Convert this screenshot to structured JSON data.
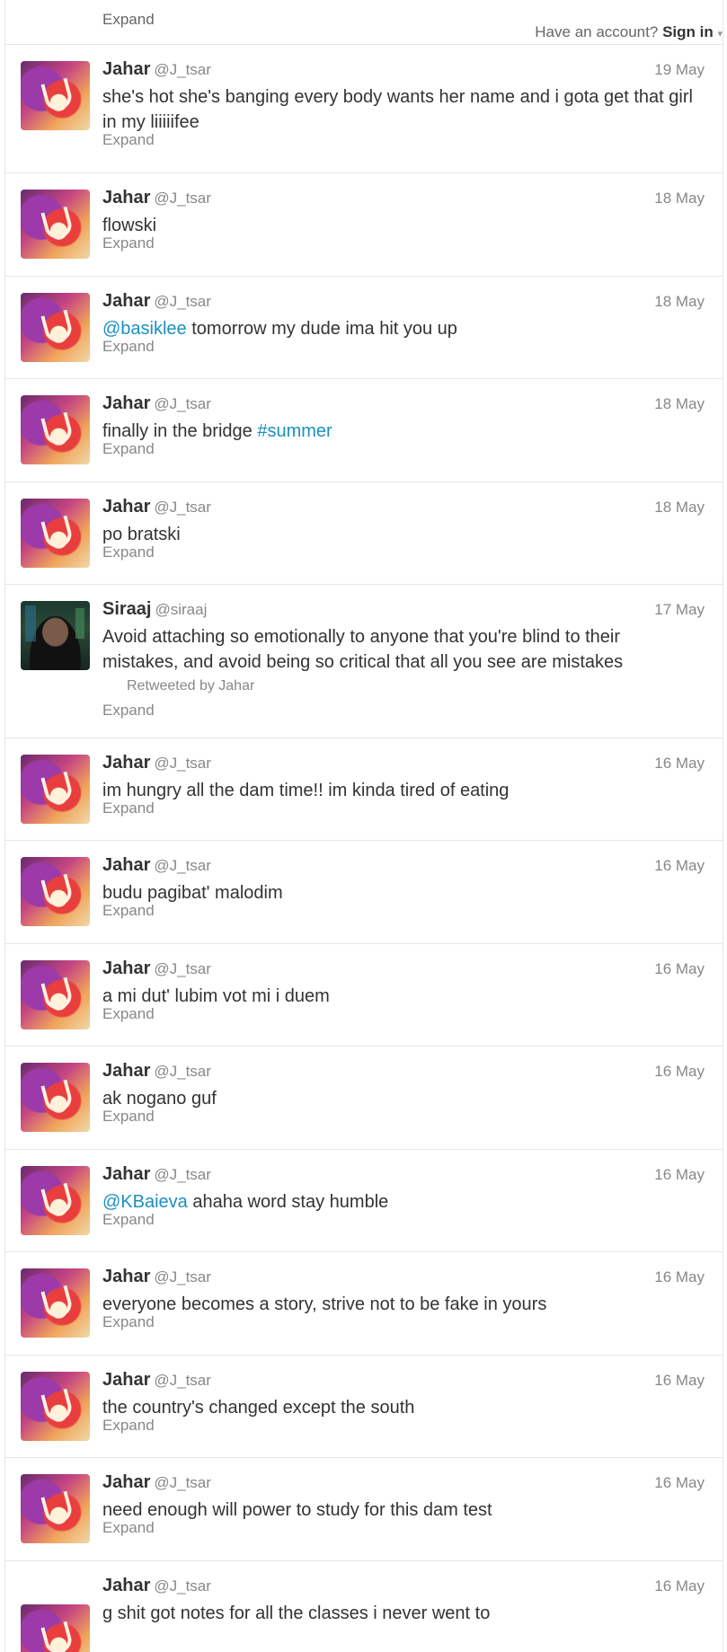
{
  "header": {
    "account_prompt": "Have an account?",
    "sign_in": "Sign in",
    "caret": "▾"
  },
  "first_expand": "Expand",
  "expand_label": "Expand",
  "tweets": [
    {
      "name": "Jahar",
      "handle": "@J_tsar",
      "time": "19 May",
      "avatar": "jahar",
      "text": [
        {
          "t": "she's hot she's banging every body wants her name and i gota get that girl in my liiiiifee"
        }
      ]
    },
    {
      "name": "Jahar",
      "handle": "@J_tsar",
      "time": "18 May",
      "avatar": "jahar",
      "text": [
        {
          "t": "flowski"
        }
      ]
    },
    {
      "name": "Jahar",
      "handle": "@J_tsar",
      "time": "18 May",
      "avatar": "jahar",
      "text": [
        {
          "t": "@basiklee",
          "link": true
        },
        {
          "t": " tomorrow my dude ima hit you up"
        }
      ]
    },
    {
      "name": "Jahar",
      "handle": "@J_tsar",
      "time": "18 May",
      "avatar": "jahar",
      "text": [
        {
          "t": "finally in the bridge "
        },
        {
          "t": "#summer",
          "link": true
        }
      ]
    },
    {
      "name": "Jahar",
      "handle": "@J_tsar",
      "time": "18 May",
      "avatar": "jahar",
      "text": [
        {
          "t": "po bratski"
        }
      ]
    },
    {
      "name": "Siraaj",
      "handle": "@siraaj",
      "time": "17 May",
      "avatar": "siraaj",
      "text": [
        {
          "t": "Avoid attaching so emotionally to anyone that you're blind to their mistakes, and avoid being so critical that all you see are mistakes"
        }
      ],
      "retweeted_by": "Retweeted by Jahar"
    },
    {
      "name": "Jahar",
      "handle": "@J_tsar",
      "time": "16 May",
      "avatar": "jahar",
      "text": [
        {
          "t": "im hungry all the dam time!! im kinda tired of eating"
        }
      ]
    },
    {
      "name": "Jahar",
      "handle": "@J_tsar",
      "time": "16 May",
      "avatar": "jahar",
      "text": [
        {
          "t": "budu pagibat' malodim"
        }
      ]
    },
    {
      "name": "Jahar",
      "handle": "@J_tsar",
      "time": "16 May",
      "avatar": "jahar",
      "text": [
        {
          "t": "a mi dut' lubim vot mi i duem"
        }
      ]
    },
    {
      "name": "Jahar",
      "handle": "@J_tsar",
      "time": "16 May",
      "avatar": "jahar",
      "text": [
        {
          "t": "ak nogano guf"
        }
      ]
    },
    {
      "name": "Jahar",
      "handle": "@J_tsar",
      "time": "16 May",
      "avatar": "jahar",
      "text": [
        {
          "t": "@KBaieva",
          "link": true
        },
        {
          "t": " ahaha word stay humble"
        }
      ]
    },
    {
      "name": "Jahar",
      "handle": "@J_tsar",
      "time": "16 May",
      "avatar": "jahar",
      "text": [
        {
          "t": "everyone becomes a story, strive not to be fake in yours"
        }
      ]
    },
    {
      "name": "Jahar",
      "handle": "@J_tsar",
      "time": "16 May",
      "avatar": "jahar",
      "text": [
        {
          "t": "the country's changed except the south"
        }
      ]
    },
    {
      "name": "Jahar",
      "handle": "@J_tsar",
      "time": "16 May",
      "avatar": "jahar",
      "text": [
        {
          "t": "need enough will power to study for this dam test"
        }
      ]
    },
    {
      "name": "Jahar",
      "handle": "@J_tsar",
      "time": "16 May",
      "avatar": "jahar",
      "text": [
        {
          "t": "g shit got notes for all the classes i never went to"
        }
      ]
    }
  ]
}
